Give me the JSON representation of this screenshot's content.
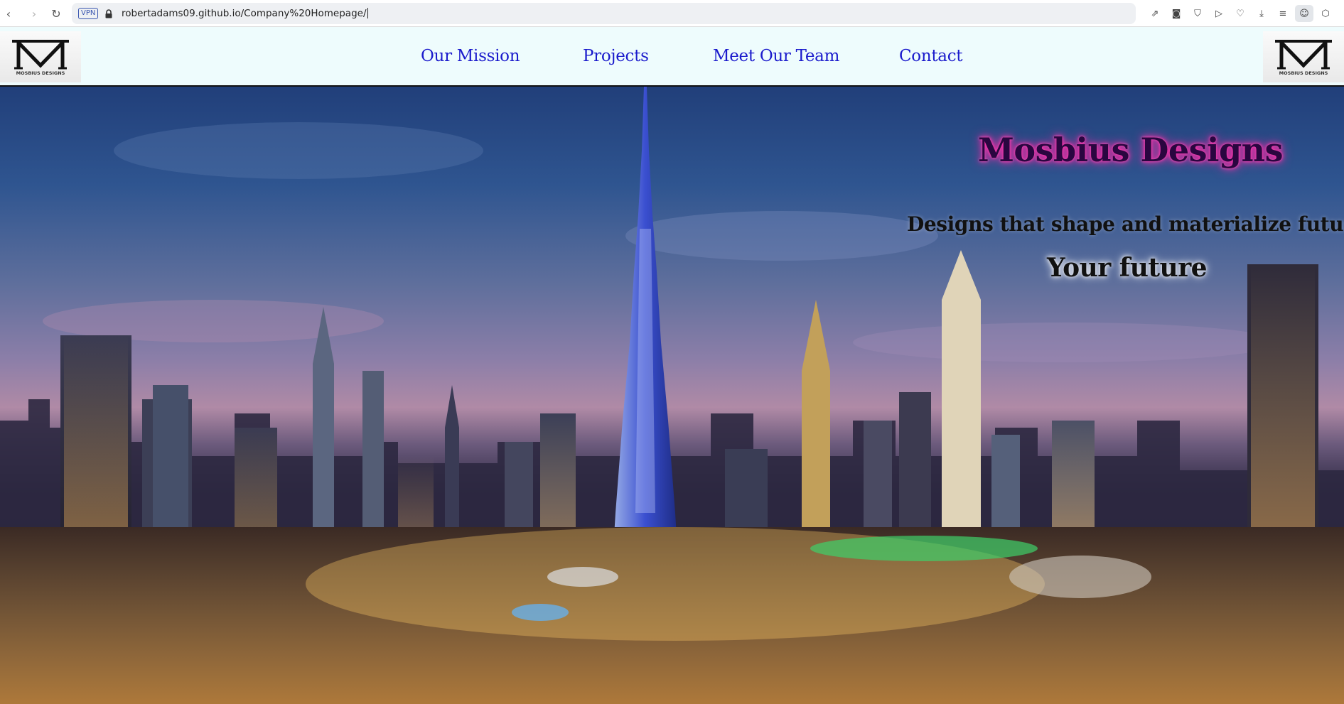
{
  "browser": {
    "url": "robertadams09.github.io/Company%20Homepage/",
    "vpn_label": "VPN",
    "back_icon": "back-arrow-icon",
    "forward_icon": "forward-arrow-icon",
    "reload_icon": "reload-icon",
    "toolbar_icons": [
      "share-icon",
      "camera-icon",
      "shield-icon",
      "play-icon",
      "heart-icon",
      "download-icon",
      "menu-icon",
      "profile-icon",
      "cube-icon"
    ]
  },
  "header": {
    "logo_alt_left": "Mosbius Designs logo",
    "logo_alt_right": "Mosbius Designs logo",
    "logo_text": "MOSBIUS DESIGNS",
    "nav": [
      {
        "label": "Our Mission"
      },
      {
        "label": "Projects"
      },
      {
        "label": "Meet Our Team"
      },
      {
        "label": "Contact"
      }
    ],
    "background": "#eefcfd",
    "link_color": "#1a1acc"
  },
  "hero": {
    "title": "Mosbius Designs",
    "tagline": "Designs that shape and materialize future",
    "subtitle": "Your future",
    "title_glow": "#ff2aa8"
  }
}
